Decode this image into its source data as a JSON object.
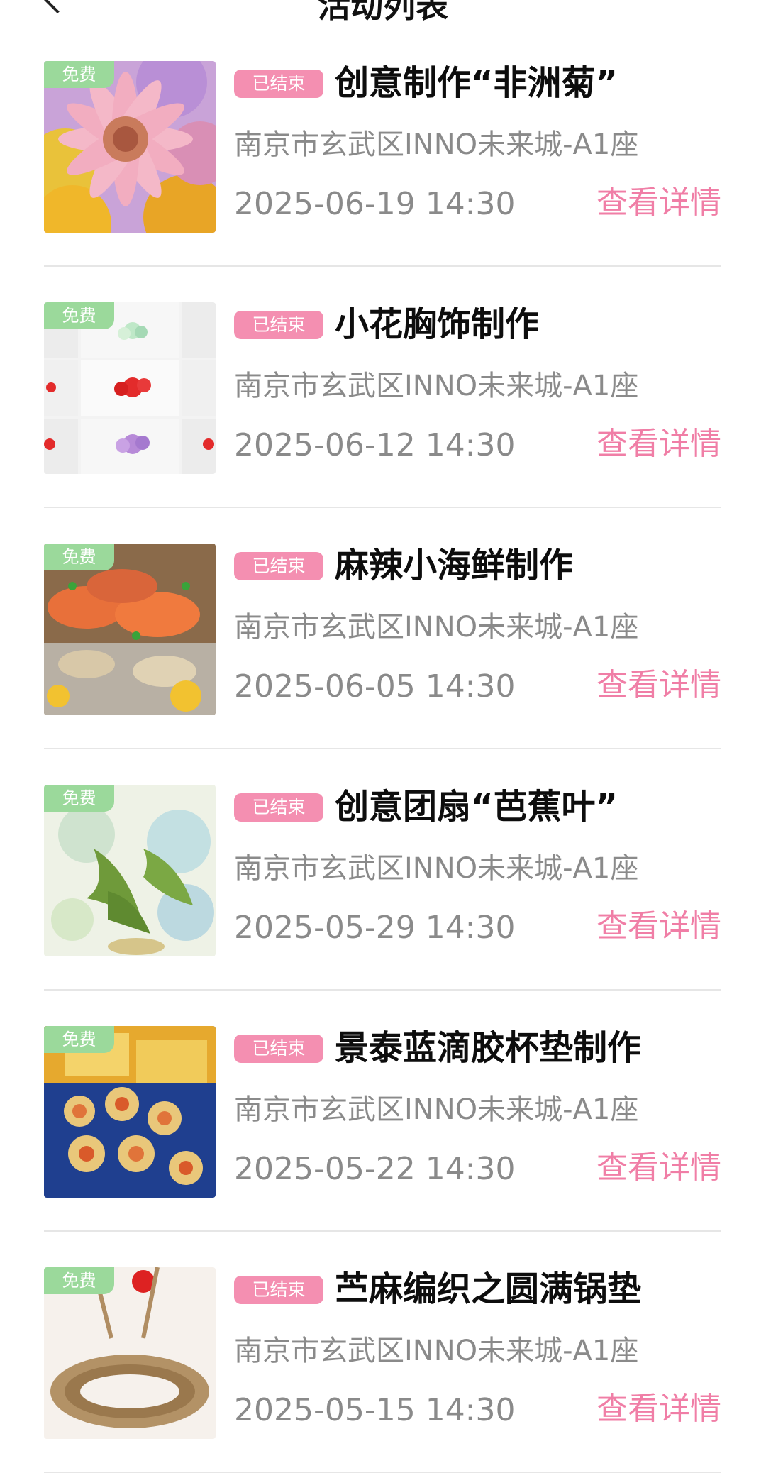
{
  "header": {
    "title": "活动列表"
  },
  "colors": {
    "free_tag": "#9bd99b",
    "status_badge": "#f48fb1",
    "detail_link": "#f07ea6",
    "muted_text": "#8a8a8a"
  },
  "events": [
    {
      "free_label": "免费",
      "status": "已结束",
      "title": "创意制作“非洲菊”",
      "location": "南京市玄武区INNO未来城-A1座",
      "datetime": "2025-06-19 14:30",
      "detail_label": "查看详情",
      "image": "gerbera-flowers"
    },
    {
      "free_label": "免费",
      "status": "已结束",
      "title": "小花胸饰制作",
      "location": "南京市玄武区INNO未来城-A1座",
      "datetime": "2025-06-12 14:30",
      "detail_label": "查看详情",
      "image": "flower-brooches-grid"
    },
    {
      "free_label": "免费",
      "status": "已结束",
      "title": "麻辣小海鲜制作",
      "location": "南京市玄武区INNO未来城-A1座",
      "datetime": "2025-06-05 14:30",
      "detail_label": "查看详情",
      "image": "spicy-seafood"
    },
    {
      "free_label": "免费",
      "status": "已结束",
      "title": "创意团扇“芭蕉叶”",
      "location": "南京市玄武区INNO未来城-A1座",
      "datetime": "2025-05-29 14:30",
      "detail_label": "查看详情",
      "image": "banana-leaf-fan"
    },
    {
      "free_label": "免费",
      "status": "已结束",
      "title": "景泰蓝滴胶杯垫制作",
      "location": "南京市玄武区INNO未来城-A1座",
      "datetime": "2025-05-22 14:30",
      "detail_label": "查看详情",
      "image": "cloisonne-coasters"
    },
    {
      "free_label": "免费",
      "status": "已结束",
      "title": "苎麻编织之圆满锅垫",
      "location": "南京市玄武区INNO未来城-A1座",
      "datetime": "2025-05-15 14:30",
      "detail_label": "查看详情",
      "image": "ramie-woven-pot-mat"
    }
  ]
}
